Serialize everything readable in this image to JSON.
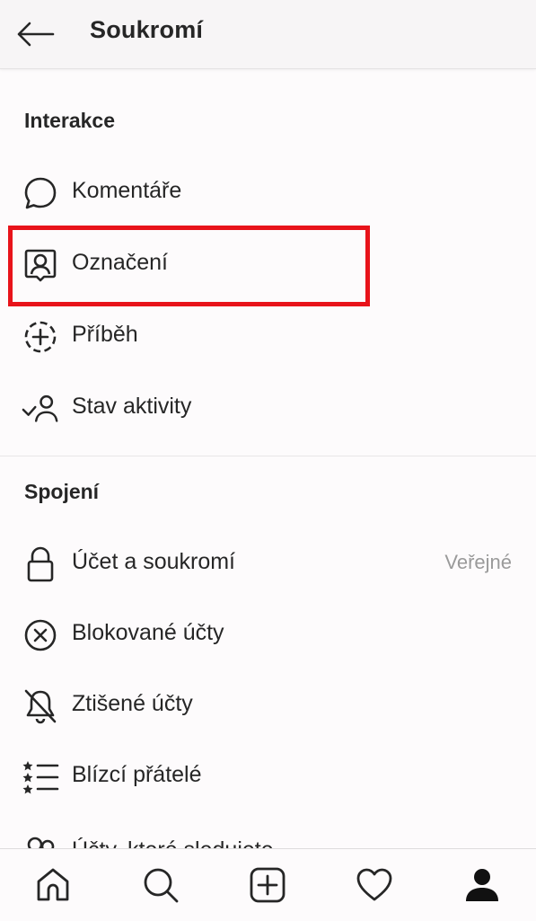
{
  "header": {
    "title": "Soukromí"
  },
  "sections": {
    "interactions": {
      "title": "Interakce",
      "items": [
        {
          "label": "Komentáře",
          "icon": "comment-icon"
        },
        {
          "label": "Označení",
          "icon": "tag-person-icon"
        },
        {
          "label": "Příběh",
          "icon": "story-add-icon"
        },
        {
          "label": "Stav aktivity",
          "icon": "activity-status-icon"
        }
      ]
    },
    "connections": {
      "title": "Spojení",
      "items": [
        {
          "label": "Účet a soukromí",
          "icon": "lock-icon",
          "value": "Veřejné"
        },
        {
          "label": "Blokované účty",
          "icon": "block-icon"
        },
        {
          "label": "Ztišené účty",
          "icon": "muted-bell-icon"
        },
        {
          "label": "Blízcí přátelé",
          "icon": "close-friends-list-icon"
        },
        {
          "label": "Účty, které sledujete",
          "icon": "following-icon"
        }
      ]
    }
  },
  "bottom_nav": [
    {
      "name": "home",
      "icon": "home-icon"
    },
    {
      "name": "search",
      "icon": "search-icon"
    },
    {
      "name": "new-post",
      "icon": "add-post-icon"
    },
    {
      "name": "activity",
      "icon": "heart-icon"
    },
    {
      "name": "profile",
      "icon": "profile-icon"
    }
  ],
  "colors": {
    "text": "#262626",
    "muted": "#9a9a9a",
    "highlight": "#e8131a",
    "background": "#fdfbfc"
  }
}
